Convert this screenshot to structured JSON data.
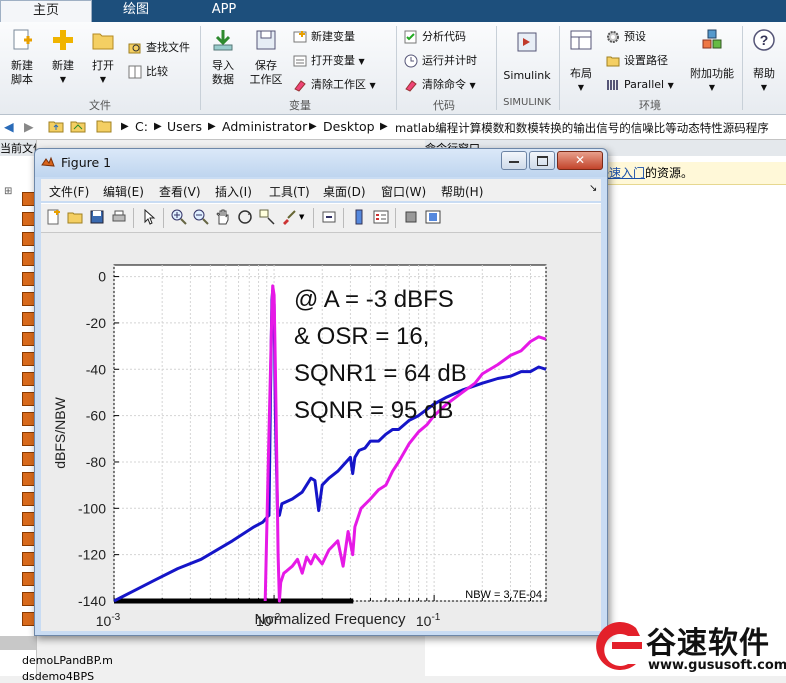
{
  "ribbon": {
    "tabs": [
      "主页",
      "绘图",
      "APP"
    ],
    "buttons": {
      "new_script": "新建\n脚本",
      "new": "新建",
      "open": "打开",
      "find_files": "查找文件",
      "compare": "比较",
      "import_data": "导入\n数据",
      "save_workspace": "保存\n工作区",
      "new_variable": "新建变量",
      "open_variable": "打开变量",
      "clear_workspace": "清除工作区",
      "analyze_code": "分析代码",
      "run_and_time": "运行并计时",
      "clear_commands": "清除命令",
      "simulink": "Simulink",
      "layout": "布局",
      "preferences": "预设",
      "set_path": "设置路径",
      "parallel": "Parallel",
      "addons": "附加功能",
      "help": "帮助"
    },
    "groups": {
      "file": "文件",
      "variable": "变量",
      "code": "代码",
      "simulink": "SIMULINK",
      "environment": "环境"
    }
  },
  "address_bar": {
    "segments": [
      "C:",
      "Users",
      "Administrator",
      "Desktop",
      "matlab编程计算模数和数模转换的输出信号的信噪比等动态特性源码程序"
    ]
  },
  "left_panel": {
    "header": "当前文件夹",
    "files": [
      "demoLPandBP.m",
      "dsdemo4BPS"
    ]
  },
  "right_panel": {
    "header": "命令行窗口",
    "info_link": "快速入门",
    "info_text": "的资源。"
  },
  "figure": {
    "title": "Figure 1",
    "menu": [
      "文件(F)",
      "编辑(E)",
      "查看(V)",
      "插入(I)",
      "工具(T)",
      "桌面(D)",
      "窗口(W)",
      "帮助(H)"
    ]
  },
  "chart_data": {
    "type": "line",
    "xscale": "log",
    "xlabel": "Normalized Frequency",
    "ylabel": "dBFS/NBW",
    "xlim": [
      0.001,
      0.5
    ],
    "ylim": [
      -140,
      5
    ],
    "x_tick_labels": [
      "10^-3",
      "10^-2",
      "10^-1"
    ],
    "y_ticks": [
      0,
      -20,
      -40,
      -60,
      -80,
      -100,
      -120,
      -140
    ],
    "annotations": [
      "@ A = -3 dBFS",
      "& OSR = 16,",
      "SQNR1 = 64 dB",
      "SQNR = 95 dB"
    ],
    "nbw_label": "NBW = 3.7E-04",
    "colors": {
      "blue": "#1515c8",
      "magenta": "#e619e6",
      "band": "#000000"
    },
    "series": [
      {
        "color": "blue",
        "x": [
          0.001,
          0.0013,
          0.0018,
          0.0025,
          0.0035,
          0.0055,
          0.0075,
          0.0085,
          0.009,
          0.0093,
          0.0095,
          0.0097,
          0.0098,
          0.01,
          0.0102,
          0.0105,
          0.0108,
          0.0112,
          0.013,
          0.015,
          0.017,
          0.018,
          0.019,
          0.02,
          0.022,
          0.025,
          0.03,
          0.031,
          0.032,
          0.034,
          0.037,
          0.04,
          0.045,
          0.05,
          0.055,
          0.06,
          0.07,
          0.08,
          0.1,
          0.12,
          0.15,
          0.2,
          0.25,
          0.3,
          0.35,
          0.4,
          0.45,
          0.5
        ],
        "y": [
          -140,
          -136,
          -131,
          -126,
          -122,
          -114,
          -108,
          -106,
          -104,
          -103,
          -50,
          -10,
          -6,
          -12,
          -60,
          -101,
          -103,
          -98,
          -96,
          -93,
          -87,
          -88,
          -101,
          -90,
          -87,
          -84,
          -78,
          -85,
          -78,
          -75,
          -74,
          -71,
          -71,
          -68,
          -66,
          -66,
          -62,
          -60,
          -55,
          -52,
          -49,
          -46,
          -44,
          -43,
          -41,
          -41,
          -39,
          -40
        ]
      },
      {
        "color": "magenta",
        "x": [
          0.0088,
          0.0092,
          0.0095,
          0.0097,
          0.0098,
          0.01,
          0.0102,
          0.0104,
          0.0106,
          0.0108,
          0.011,
          0.0115,
          0.012,
          0.013,
          0.014,
          0.015,
          0.016,
          0.017,
          0.018,
          0.02,
          0.022,
          0.025,
          0.027,
          0.029,
          0.031,
          0.032,
          0.035,
          0.04,
          0.045,
          0.05,
          0.055,
          0.06,
          0.07,
          0.08,
          0.09,
          0.1,
          0.12,
          0.15,
          0.18,
          0.2,
          0.25,
          0.3,
          0.35,
          0.4,
          0.45,
          0.5
        ],
        "y": [
          -140,
          -80,
          -40,
          -15,
          -4,
          -8,
          -40,
          -80,
          -120,
          -140,
          -132,
          -128,
          -127,
          -125,
          -122,
          -128,
          -121,
          -124,
          -120,
          -124,
          -118,
          -114,
          -125,
          -110,
          -120,
          -108,
          -100,
          -96,
          -92,
          -90,
          -84,
          -80,
          -72,
          -67,
          -64,
          -60,
          -55,
          -50,
          -46,
          -42,
          -38,
          -34,
          -32,
          -28,
          -26,
          -27
        ]
      }
    ],
    "black_band": {
      "x": [
        0.001,
        0.03125
      ],
      "y": -140
    }
  },
  "watermark": {
    "brand": "谷速软件",
    "url": "www.gususoft.com"
  }
}
